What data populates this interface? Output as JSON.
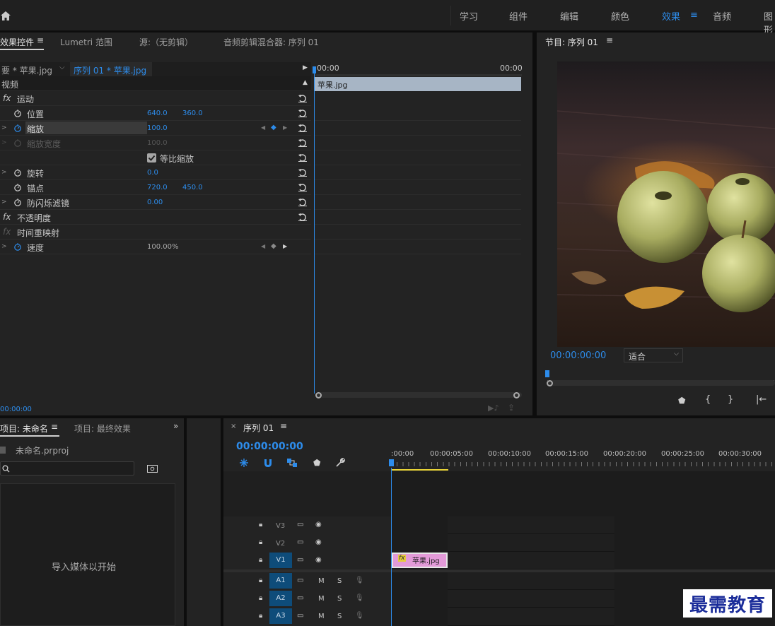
{
  "topnav": {
    "items": [
      "学习",
      "组件",
      "编辑",
      "颜色",
      "效果",
      "音频",
      "图形"
    ],
    "active": "效果"
  },
  "effects_panel": {
    "tabs": [
      "效果控件",
      "Lumetri 范围",
      "源:（无剪辑）",
      "音频剪辑混合器: 序列 01"
    ],
    "master": "要 * 苹果.jpg",
    "sequence_clip": "序列 01 * 苹果.jpg",
    "ruler_start": "00:00",
    "ruler_end": "00:00",
    "clip_label": "苹果.jpg",
    "section": "视频",
    "rows": [
      {
        "label": "运动",
        "fx": true
      },
      {
        "label": "位置",
        "v1": "640.0",
        "v2": "360.0"
      },
      {
        "label": "缩放",
        "v1": "100.0"
      },
      {
        "label": "缩放宽度",
        "v1": "100.0"
      },
      {
        "label": "等比缩放"
      },
      {
        "label": "旋转",
        "v1": "0.0"
      },
      {
        "label": "锚点",
        "v1": "720.0",
        "v2": "450.0"
      },
      {
        "label": "防闪烁滤镜",
        "v1": "0.00"
      },
      {
        "label": "不透明度",
        "fx": true
      },
      {
        "label": "时间重映射",
        "fx": true
      },
      {
        "label": "速度",
        "v1": "100.00%"
      }
    ],
    "timecode": "00:00:00"
  },
  "program": {
    "title": "节目: 序列 01",
    "timecode": "00:00:00:00",
    "fit": "适合"
  },
  "project": {
    "tabs": [
      "项目: 未命名",
      "项目: 最终效果"
    ],
    "file": "未命名.prproj",
    "empty_text": "导入媒体以开始"
  },
  "timeline": {
    "tab": "序列 01",
    "timecode": "00:00:00:00",
    "ruler": [
      ":00:00",
      "00:00:05:00",
      "00:00:10:00",
      "00:00:15:00",
      "00:00:20:00",
      "00:00:25:00",
      "00:00:30:00"
    ],
    "tracks": [
      "V3",
      "V2",
      "V1",
      "A1",
      "A2",
      "A3"
    ],
    "clip": "苹果.jpg",
    "m": "M",
    "s": "S",
    "fx": "fx"
  },
  "watermark": "最需教育"
}
